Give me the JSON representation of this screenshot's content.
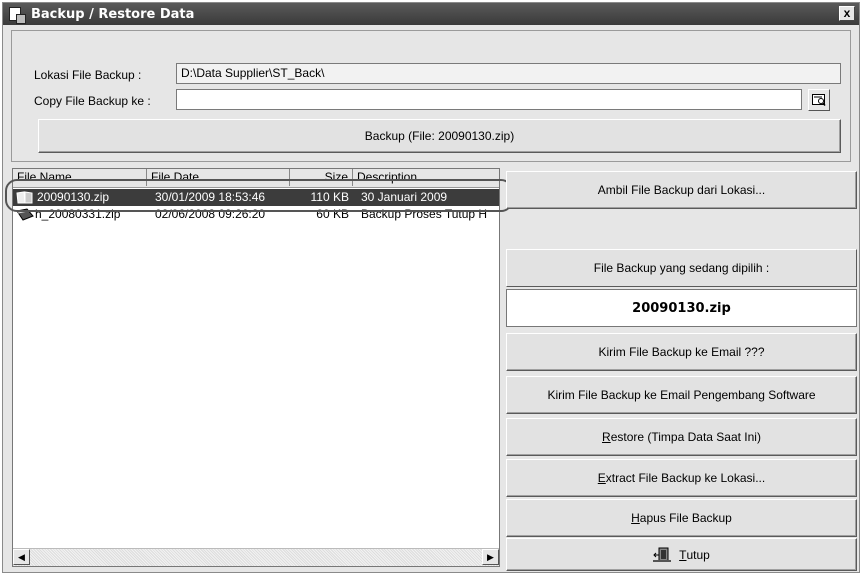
{
  "window": {
    "title": "Backup / Restore Data",
    "close_label": "x"
  },
  "backup": {
    "location_label": "Lokasi File Backup :",
    "location_value": "D:\\Data Supplier\\ST_Back\\",
    "copy_label": "Copy File Backup ke :",
    "copy_value": "",
    "backup_button": "Backup (File: 20090130.zip)"
  },
  "file_list": {
    "columns": [
      "File Name",
      "File Date",
      "Size",
      "Description"
    ],
    "rows": [
      {
        "name": "20090130.zip",
        "date": "30/01/2009 18:53:46",
        "size": "110 KB",
        "description": "30 Januari 2009",
        "selected": true
      },
      {
        "name": "h_20080331.zip",
        "date": "02/06/2008 09:26:20",
        "size": "60 KB",
        "description": "Backup Proses Tutup H",
        "selected": false
      }
    ]
  },
  "actions": {
    "get_backup": "Ambil File Backup dari Lokasi...",
    "selected_label": "File Backup yang sedang dipilih :",
    "selected_file": "20090130.zip",
    "send_email": "Kirim File Backup ke Email ???",
    "send_dev": "Kirim File Backup ke Email Pengembang Software",
    "restore_key": "R",
    "restore_rest": "estore (Timpa Data Saat Ini)",
    "extract_key": "E",
    "extract_rest": "xtract File Backup ke Lokasi...",
    "delete_key": "H",
    "delete_rest": "apus File Backup",
    "close_key": "T",
    "close_rest": "utup"
  },
  "colors": {
    "selection": "#3c3c3c",
    "title_bar": "#4a4a4a",
    "face": "#e6e6e6"
  }
}
